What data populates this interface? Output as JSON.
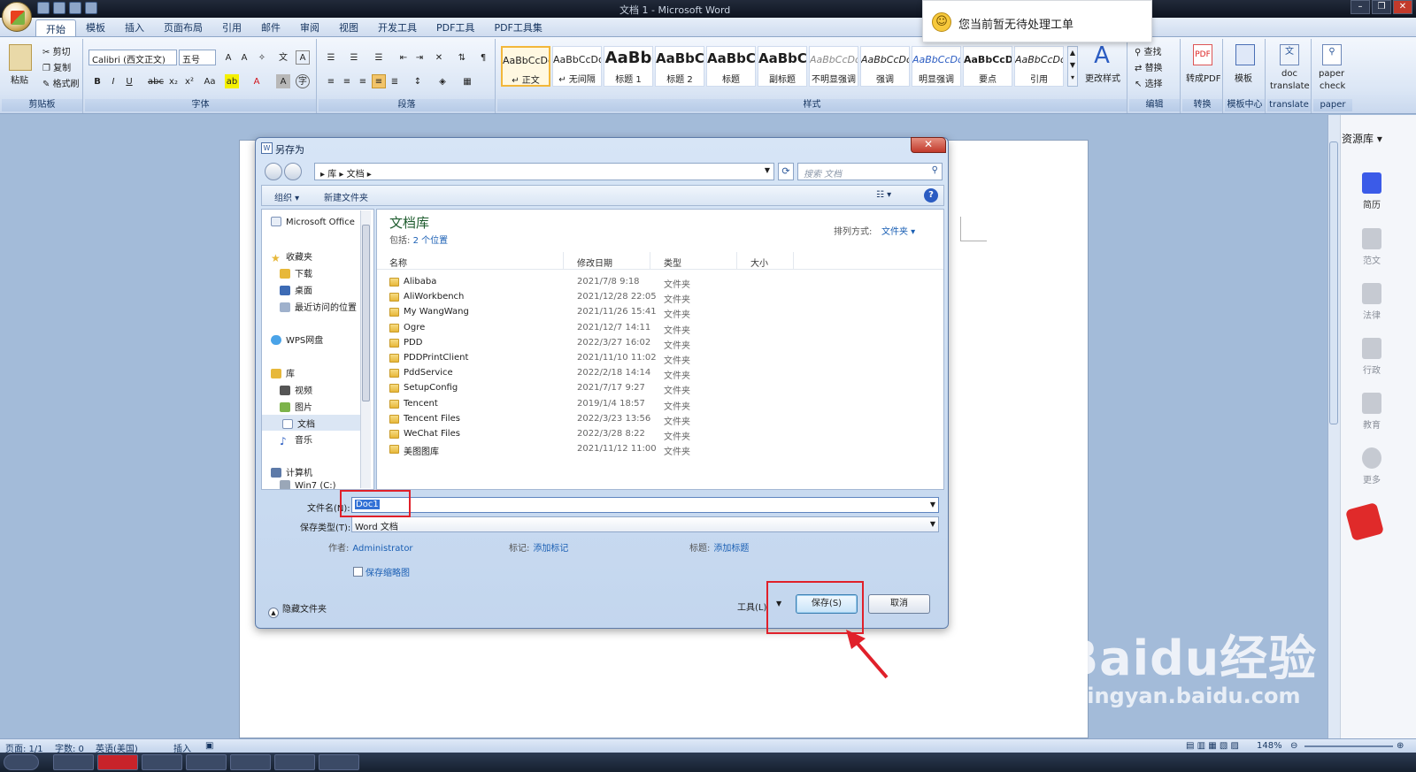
{
  "window": {
    "title": "文档 1 - Microsoft Word"
  },
  "tabs": [
    "开始",
    "模板",
    "插入",
    "页面布局",
    "引用",
    "邮件",
    "审阅",
    "视图",
    "开发工具",
    "PDF工具",
    "PDF工具集"
  ],
  "ribbon": {
    "clipboard": {
      "paste": "粘贴",
      "cut": "剪切",
      "copy": "复制",
      "format_painter": "格式刷",
      "group": "剪贴板"
    },
    "font": {
      "name": "Calibri (西文正文)",
      "size": "五号",
      "group": "字体"
    },
    "paragraph": {
      "group": "段落"
    },
    "styles": {
      "items": [
        {
          "sample": "AaBbCcDd",
          "name": "↵ 正文"
        },
        {
          "sample": "AaBbCcDd",
          "name": "↵ 无间隔"
        },
        {
          "sample": "AaBb",
          "name": "标题 1"
        },
        {
          "sample": "AaBbC",
          "name": "标题 2"
        },
        {
          "sample": "AaBbC",
          "name": "标题"
        },
        {
          "sample": "AaBbC",
          "name": "副标题"
        },
        {
          "sample": "AaBbCcDd",
          "name": "不明显强调"
        },
        {
          "sample": "AaBbCcDd",
          "name": "强调"
        },
        {
          "sample": "AaBbCcDd",
          "name": "明显强调"
        },
        {
          "sample": "AaBbCcDd",
          "name": "要点"
        },
        {
          "sample": "AaBbCcDd",
          "name": "引用"
        }
      ],
      "change_styles": "更改样式",
      "group": "样式"
    },
    "editing": {
      "find": "查找",
      "replace": "替换",
      "select": "选择",
      "group": "编辑"
    },
    "convert": {
      "label": "转成PDF",
      "group": "转换"
    },
    "template": {
      "label": "模板",
      "group": "模板中心"
    },
    "doc_translate": {
      "label1": "doc",
      "label2": "translate",
      "group": "translate"
    },
    "paper_check": {
      "label1": "paper",
      "label2": "check",
      "group": "paper"
    }
  },
  "notification": {
    "text": "您当前暂无待处理工单"
  },
  "side_panel": {
    "title": "资源库 ▾",
    "items": [
      "简历",
      "范文",
      "法律",
      "行政",
      "教育",
      "更多"
    ]
  },
  "dialog": {
    "title": "另存为",
    "breadcrumb": [
      "库",
      "文档"
    ],
    "search_placeholder": "搜索 文档",
    "toolbar": {
      "organize": "组织 ▾",
      "new_folder": "新建文件夹"
    },
    "nav": {
      "office": "Microsoft Office",
      "favorites": "收藏夹",
      "downloads": "下载",
      "desktop": "桌面",
      "recent": "最近访问的位置",
      "wps": "WPS网盘",
      "libraries": "库",
      "videos": "视频",
      "pictures": "图片",
      "documents": "文档",
      "music": "音乐",
      "computer": "计算机",
      "drive": "Win7 (C:)"
    },
    "library": {
      "title": "文档库",
      "includes_label": "包括:",
      "includes_link": "2 个位置",
      "sort_label": "排列方式:",
      "sort_value": "文件夹 ▾"
    },
    "columns": {
      "name": "名称",
      "date": "修改日期",
      "type": "类型",
      "size": "大小"
    },
    "files": [
      {
        "name": "Alibaba",
        "date": "2021/7/8 9:18",
        "type": "文件夹"
      },
      {
        "name": "AliWorkbench",
        "date": "2021/12/28 22:05",
        "type": "文件夹"
      },
      {
        "name": "My WangWang",
        "date": "2021/11/26 15:41",
        "type": "文件夹"
      },
      {
        "name": "Ogre",
        "date": "2021/12/7 14:11",
        "type": "文件夹"
      },
      {
        "name": "PDD",
        "date": "2022/3/27 16:02",
        "type": "文件夹"
      },
      {
        "name": "PDDPrintClient",
        "date": "2021/11/10 11:02",
        "type": "文件夹"
      },
      {
        "name": "PddService",
        "date": "2022/2/18 14:14",
        "type": "文件夹"
      },
      {
        "name": "SetupConfig",
        "date": "2021/7/17 9:27",
        "type": "文件夹"
      },
      {
        "name": "Tencent",
        "date": "2019/1/4 18:57",
        "type": "文件夹"
      },
      {
        "name": "Tencent Files",
        "date": "2022/3/23 13:56",
        "type": "文件夹"
      },
      {
        "name": "WeChat Files",
        "date": "2022/3/28 8:22",
        "type": "文件夹"
      },
      {
        "name": "美图图库",
        "date": "2021/11/12 11:00",
        "type": "文件夹"
      }
    ],
    "filename_label": "文件名(N):",
    "filename_value": "Doc1",
    "filetype_label": "保存类型(T):",
    "filetype_value": "Word 文档",
    "author_label": "作者:",
    "author_value": "Administrator",
    "tags_label": "标记:",
    "tags_value": "添加标记",
    "title_label": "标题:",
    "title_value": "添加标题",
    "thumbnail_label": "保存缩略图",
    "hide_folders": "隐藏文件夹",
    "tools_label": "工具(L)",
    "save_label": "保存(S)",
    "cancel_label": "取消"
  },
  "status": {
    "page": "页面: 1/1",
    "words": "字数: 0",
    "language": "英语(美国)",
    "insert": "插入",
    "zoom": "148%"
  },
  "watermark": {
    "line1": "Baidu经验",
    "line2": "jingyan.baidu.com"
  },
  "colors": {
    "accent": "#2b579a",
    "highlight_red": "#e0202a"
  }
}
